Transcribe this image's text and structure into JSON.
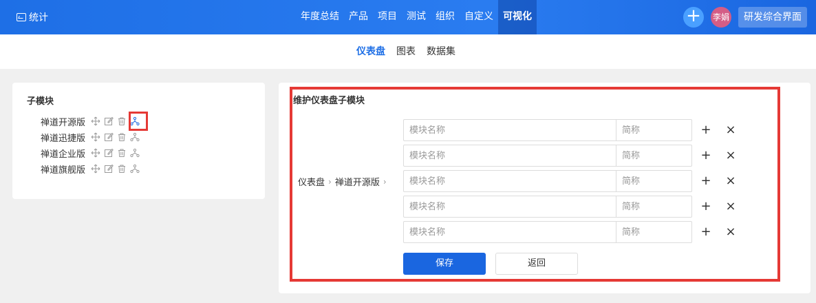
{
  "header": {
    "app_name": "统计",
    "nav": [
      "年度总结",
      "产品",
      "项目",
      "测试",
      "组织",
      "自定义",
      "可视化"
    ],
    "active_nav": "可视化",
    "user_initials": "李娟",
    "product_switch": "研发综合界面",
    "plus_symbol": "+"
  },
  "subnav": {
    "items": [
      "仪表盘",
      "图表",
      "数据集"
    ],
    "active": "仪表盘"
  },
  "left_panel": {
    "title": "子模块",
    "modules": [
      "禅道开源版",
      "禅道迅捷版",
      "禅道企业版",
      "禅道旗舰版"
    ]
  },
  "right_panel": {
    "title": "维护仪表盘子模块",
    "breadcrumb": [
      "仪表盘",
      "禅道开源版"
    ],
    "breadcrumb_sep": "›",
    "rows": [
      {
        "name_placeholder": "模块名称",
        "abbr_placeholder": "简称"
      },
      {
        "name_placeholder": "模块名称",
        "abbr_placeholder": "简称"
      },
      {
        "name_placeholder": "模块名称",
        "abbr_placeholder": "简称"
      },
      {
        "name_placeholder": "模块名称",
        "abbr_placeholder": "简称"
      },
      {
        "name_placeholder": "模块名称",
        "abbr_placeholder": "简称"
      }
    ],
    "add_symbol": "+",
    "remove_symbol": "×",
    "save_label": "保存",
    "back_label": "返回"
  },
  "colors": {
    "primary": "#1a66e0",
    "highlight": "#e53935"
  }
}
